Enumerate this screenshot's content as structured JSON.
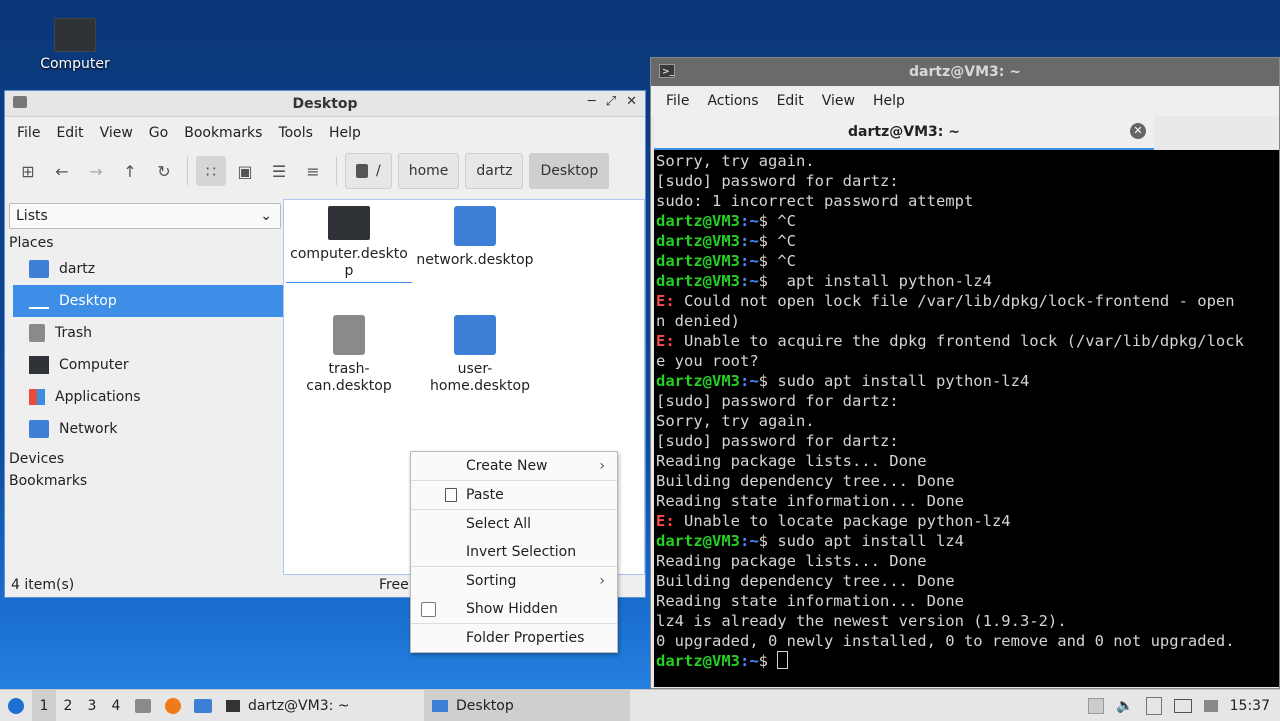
{
  "desktop": {
    "computer_label": "Computer"
  },
  "file_manager": {
    "title": "Desktop",
    "menu": [
      "File",
      "Edit",
      "View",
      "Go",
      "Bookmarks",
      "Tools",
      "Help"
    ],
    "breadcrumb": [
      "/",
      "home",
      "dartz",
      "Desktop"
    ],
    "sidebar_mode": "Lists",
    "sections": {
      "places": "Places",
      "devices": "Devices",
      "bookmarks": "Bookmarks"
    },
    "places": [
      "dartz",
      "Desktop",
      "Trash",
      "Computer",
      "Applications",
      "Network"
    ],
    "selected_place": "Desktop",
    "files": [
      {
        "label": "computer.desktop",
        "icon": "computer-icon"
      },
      {
        "label": "network.desktop",
        "icon": "network-folder-icon"
      },
      {
        "label": "trash-can.desktop",
        "icon": "trash-icon"
      },
      {
        "label": "user-home.desktop",
        "icon": "home-folder-icon"
      }
    ],
    "status_left": "4 item(s)",
    "status_right": "Free"
  },
  "context_menu": {
    "create_new": "Create New",
    "paste": "Paste",
    "select_all": "Select All",
    "invert_selection": "Invert Selection",
    "sorting": "Sorting",
    "show_hidden": "Show Hidden",
    "folder_properties": "Folder Properties"
  },
  "terminal": {
    "title": "dartz@VM3: ~",
    "menu": [
      "File",
      "Actions",
      "Edit",
      "View",
      "Help"
    ],
    "tab_title": "dartz@VM3: ~",
    "prompt_user": "dartz@VM3",
    "prompt_path": "~",
    "lines": [
      {
        "t": "text",
        "v": "Sorry, try again."
      },
      {
        "t": "text",
        "v": "[sudo] password for dartz:"
      },
      {
        "t": "text",
        "v": "sudo: 1 incorrect password attempt"
      },
      {
        "t": "cmd",
        "v": " ^C"
      },
      {
        "t": "cmd",
        "v": " ^C"
      },
      {
        "t": "cmd",
        "v": " ^C"
      },
      {
        "t": "cmd",
        "v": "  apt install python-lz4"
      },
      {
        "t": "err",
        "v": " Could not open lock file /var/lib/dpkg/lock-frontend - open"
      },
      {
        "t": "text",
        "v": "n denied)"
      },
      {
        "t": "err",
        "v": " Unable to acquire the dpkg frontend lock (/var/lib/dpkg/lock"
      },
      {
        "t": "text",
        "v": "e you root?"
      },
      {
        "t": "cmd",
        "v": " sudo apt install python-lz4"
      },
      {
        "t": "text",
        "v": "[sudo] password for dartz:"
      },
      {
        "t": "text",
        "v": "Sorry, try again."
      },
      {
        "t": "text",
        "v": "[sudo] password for dartz:"
      },
      {
        "t": "text",
        "v": "Reading package lists... Done"
      },
      {
        "t": "text",
        "v": "Building dependency tree... Done"
      },
      {
        "t": "text",
        "v": "Reading state information... Done"
      },
      {
        "t": "err",
        "v": " Unable to locate package python-lz4"
      },
      {
        "t": "cmd",
        "v": " sudo apt install lz4"
      },
      {
        "t": "text",
        "v": "Reading package lists... Done"
      },
      {
        "t": "text",
        "v": "Building dependency tree... Done"
      },
      {
        "t": "text",
        "v": "Reading state information... Done"
      },
      {
        "t": "text",
        "v": "lz4 is already the newest version (1.9.3-2)."
      },
      {
        "t": "text",
        "v": "0 upgraded, 0 newly installed, 0 to remove and 0 not upgraded."
      },
      {
        "t": "cmd",
        "v": " ",
        "cursor": true
      }
    ],
    "error_prefix": "E:"
  },
  "taskbar": {
    "workspaces": [
      "1",
      "2",
      "3",
      "4"
    ],
    "tasks": [
      "dartz@VM3: ~",
      "Desktop"
    ],
    "clock": "15:37"
  },
  "colors": {
    "selection": "#3d8ee6",
    "prompt": "#23d023",
    "path": "#4d8cff",
    "error": "#ff4a4a"
  }
}
